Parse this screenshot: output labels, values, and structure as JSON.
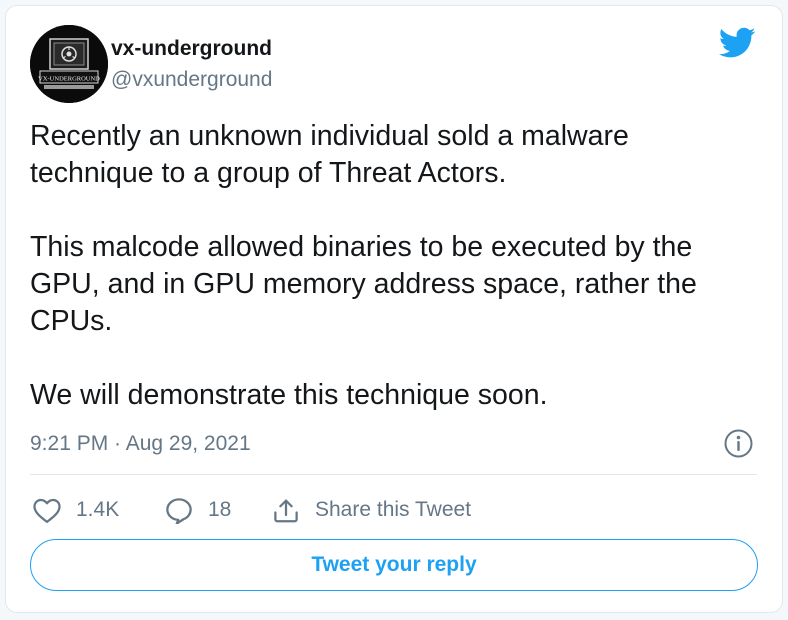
{
  "tweet": {
    "display_name": "vx-underground",
    "handle": "@vxunderground",
    "avatar_text": "VX-UNDERGROUND",
    "paragraphs": [
      "Recently an unknown individual sold a malware technique to a group of Threat Actors.",
      "This malcode allowed binaries to be executed by the GPU, and in GPU memory address space, rather the CPUs.",
      "We will demonstrate this technique soon."
    ],
    "timestamp": "9:21 PM · Aug 29, 2021"
  },
  "actions": {
    "likes_count": "1.4K",
    "replies_count": "18",
    "share_label": "Share this Tweet"
  },
  "reply_button_label": "Tweet your reply",
  "icons": {
    "brand": "twitter-bird-icon",
    "info": "info-icon",
    "like": "heart-icon",
    "reply": "reply-bubble-icon",
    "share": "share-icon"
  },
  "colors": {
    "accent": "#1da1f2",
    "text_primary": "#14171a",
    "text_secondary": "#657786",
    "border": "#e1e8ed"
  }
}
